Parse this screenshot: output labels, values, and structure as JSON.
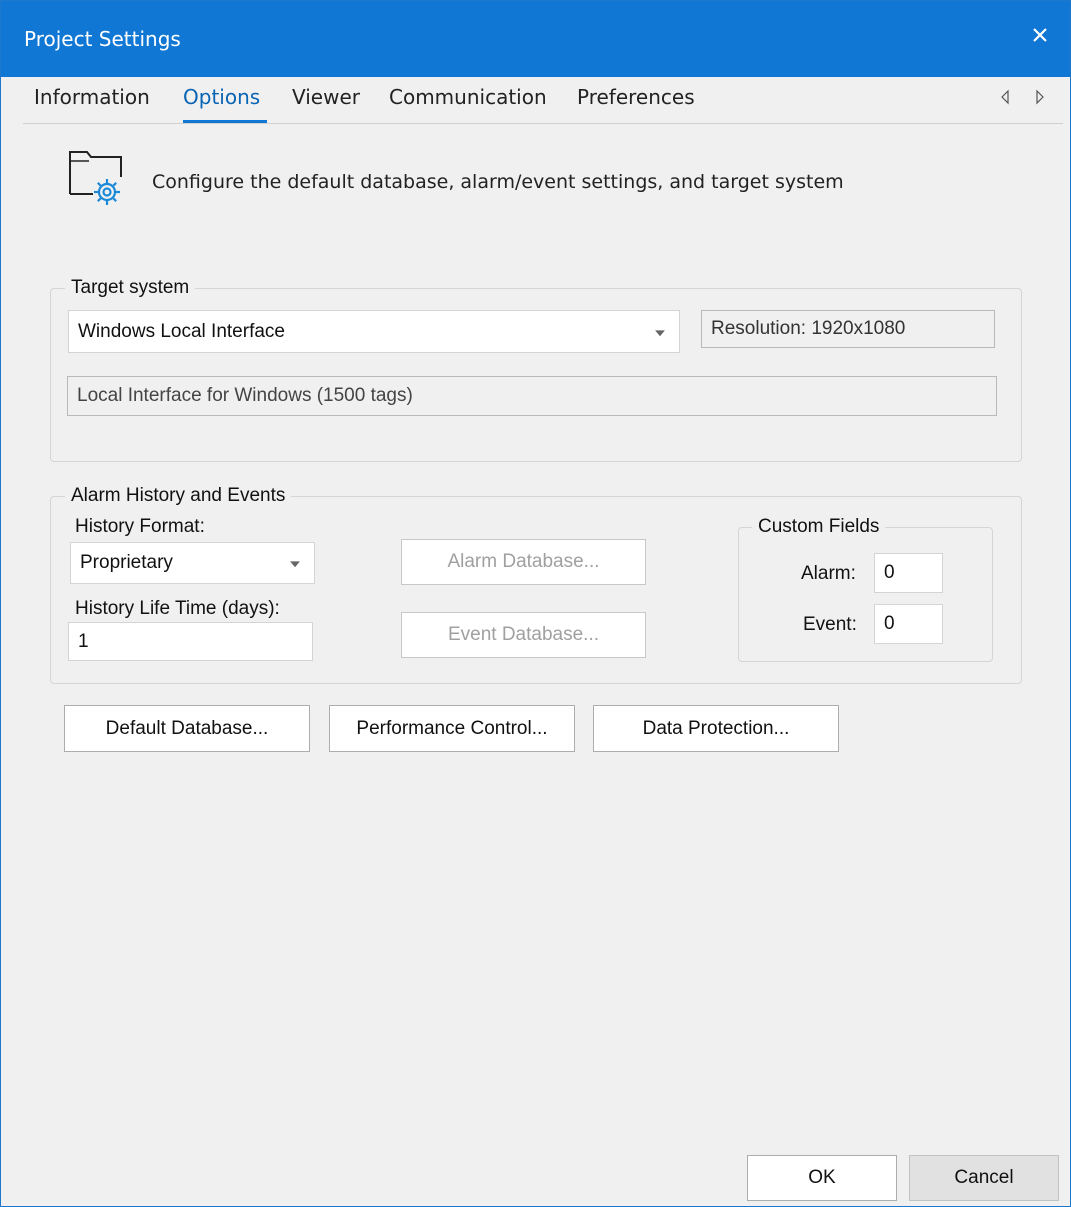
{
  "window": {
    "title": "Project Settings"
  },
  "tabs": [
    {
      "label": "Information"
    },
    {
      "label": "Options",
      "active": true
    },
    {
      "label": "Viewer"
    },
    {
      "label": "Communication"
    },
    {
      "label": "Preferences"
    }
  ],
  "header": {
    "icon": "folder-gear-icon",
    "description": "Configure the default database, alarm/event settings, and target system"
  },
  "target_system": {
    "legend": "Target system",
    "selected": "Windows Local Interface",
    "resolution": "Resolution: 1920x1080",
    "details": "Local Interface for Windows (1500 tags)"
  },
  "alarm_history": {
    "legend": "Alarm History and Events",
    "history_format_label": "History Format:",
    "history_format_value": "Proprietary",
    "life_time_label": "History Life Time (days):",
    "life_time_value": "1",
    "alarm_db_button": "Alarm Database...",
    "event_db_button": "Event Database...",
    "custom_fields": {
      "legend": "Custom Fields",
      "alarm_label": "Alarm:",
      "alarm_value": "0",
      "event_label": "Event:",
      "event_value": "0"
    }
  },
  "actions": {
    "default_db": "Default Database...",
    "performance": "Performance Control...",
    "data_protection": "Data Protection..."
  },
  "footer": {
    "ok": "OK",
    "cancel": "Cancel"
  },
  "colors": {
    "titlebar": "#1177d4",
    "accent": "#0a64b4"
  }
}
